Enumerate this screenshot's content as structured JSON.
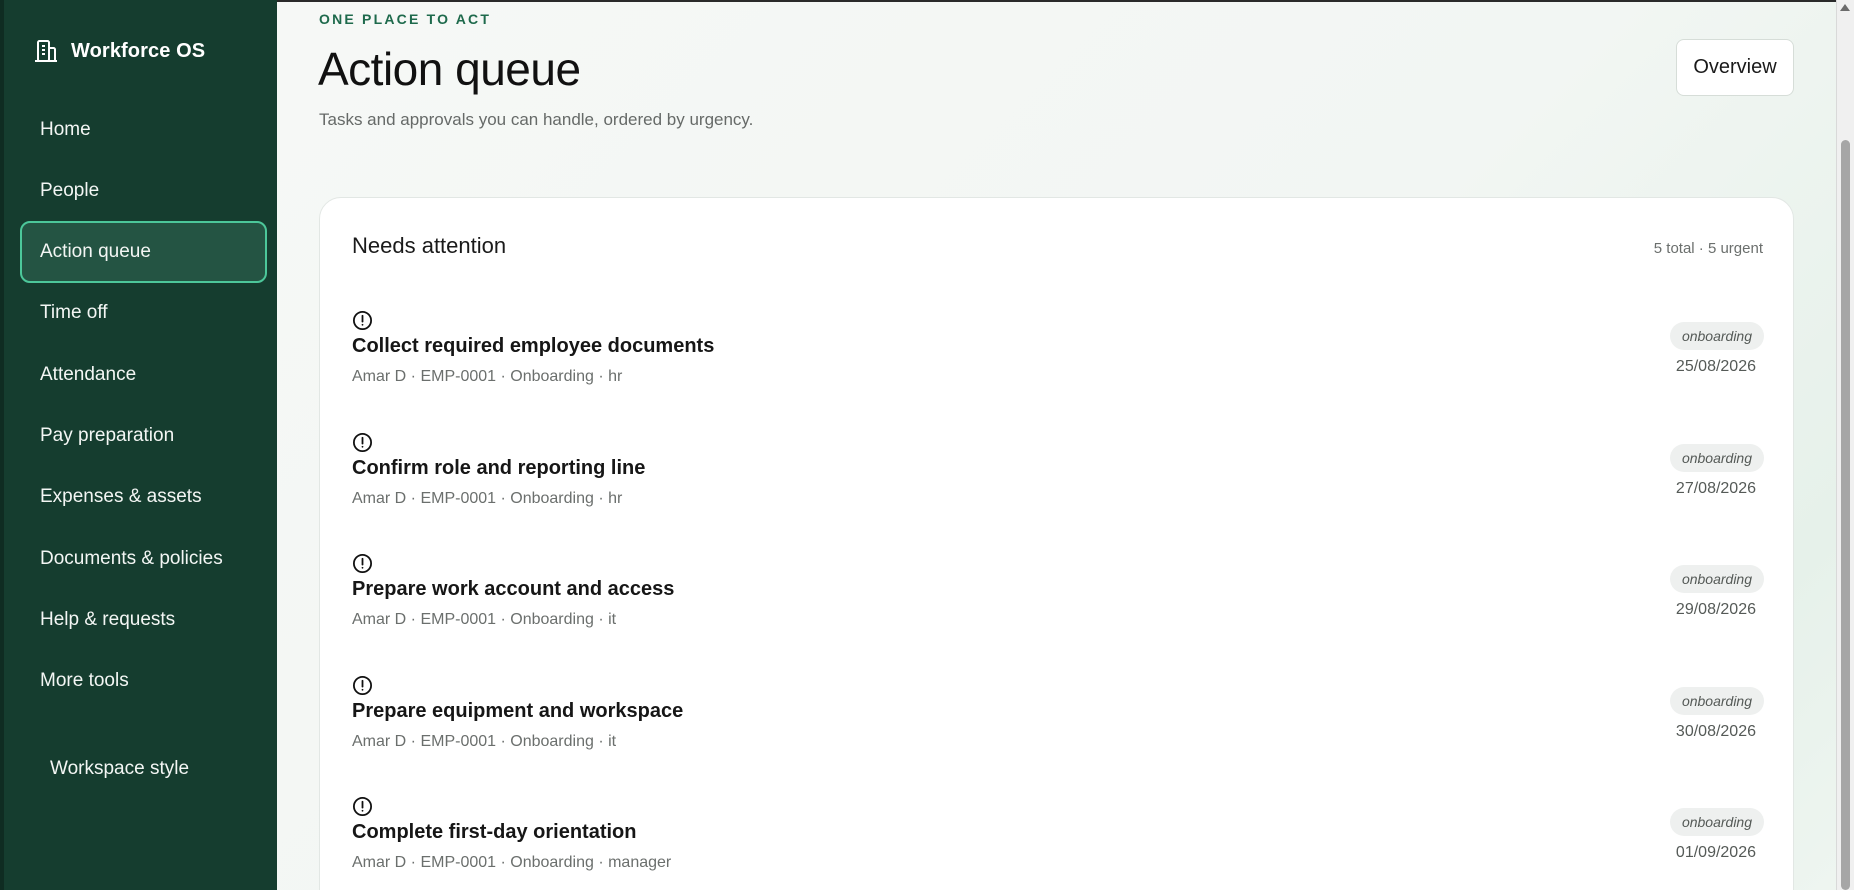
{
  "app": {
    "brand_name": "Workforce OS",
    "brand_icon": "building-icon"
  },
  "sidebar": {
    "items": [
      {
        "label": "Home"
      },
      {
        "label": "People"
      },
      {
        "label": "Action queue",
        "active": true
      },
      {
        "label": "Time off"
      },
      {
        "label": "Attendance"
      },
      {
        "label": "Pay preparation"
      },
      {
        "label": "Expenses & assets"
      },
      {
        "label": "Documents & policies"
      },
      {
        "label": "Help & requests"
      },
      {
        "label": "More tools"
      }
    ],
    "workspace_style": "Workspace style"
  },
  "header": {
    "eyebrow": "ONE PLACE TO ACT",
    "title": "Action queue",
    "subtitle": "Tasks and approvals you can handle, ordered by urgency.",
    "overview_button": "Overview"
  },
  "card": {
    "title": "Needs attention",
    "count": "5 total · 5 urgent",
    "rows": [
      {
        "title": "Collect required employee documents",
        "meta": "Amar D · EMP-0001 · Onboarding · hr",
        "tag": "onboarding",
        "date": "25/08/2026"
      },
      {
        "title": "Confirm role and reporting line",
        "meta": "Amar D · EMP-0001 · Onboarding · hr",
        "tag": "onboarding",
        "date": "27/08/2026"
      },
      {
        "title": "Prepare work account and access",
        "meta": "Amar D · EMP-0001 · Onboarding · it",
        "tag": "onboarding",
        "date": "29/08/2026"
      },
      {
        "title": "Prepare equipment and workspace",
        "meta": "Amar D · EMP-0001 · Onboarding · it",
        "tag": "onboarding",
        "date": "30/08/2026"
      },
      {
        "title": "Complete first-day orientation",
        "meta": "Amar D · EMP-0001 · Onboarding · manager",
        "tag": "onboarding",
        "date": "01/09/2026"
      }
    ]
  },
  "colors": {
    "sidebar_bg": "#153d2f",
    "active_border": "#4cc79a",
    "accent": "#1e6a4c"
  }
}
